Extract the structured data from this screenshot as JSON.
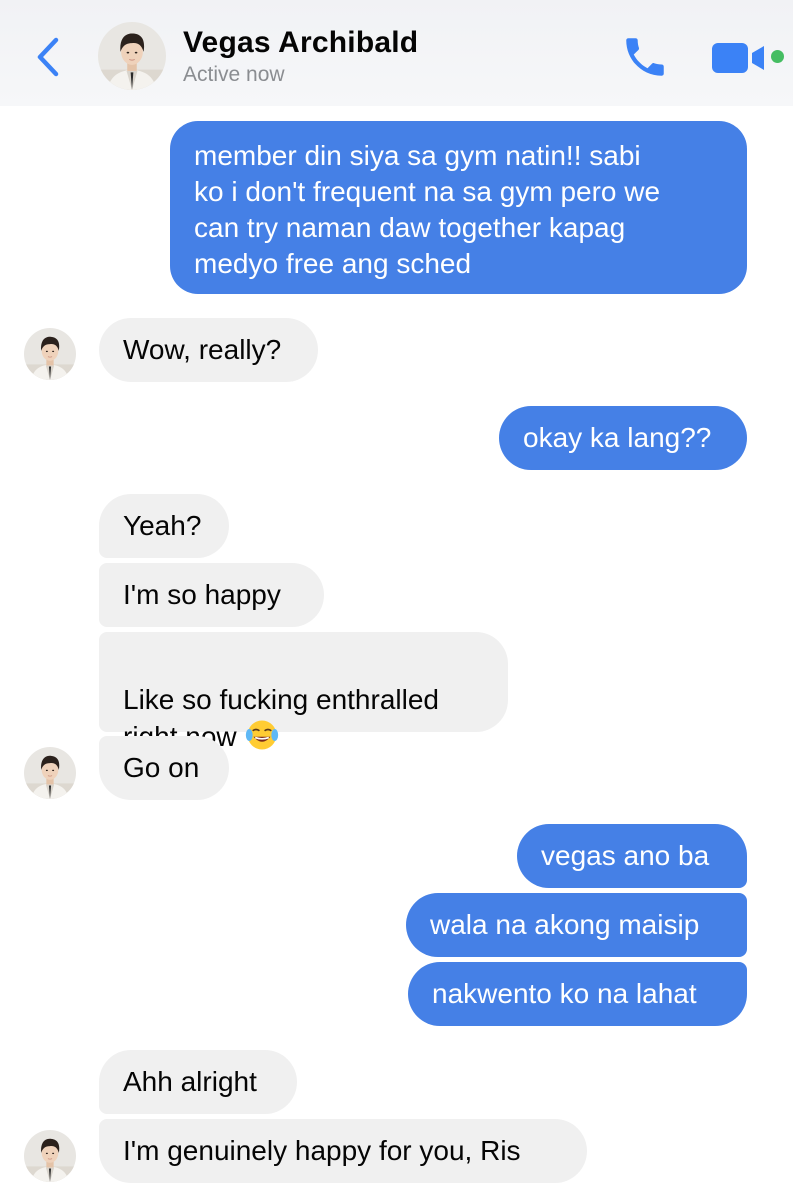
{
  "header": {
    "contact_name": "Vegas Archibald",
    "status": "Active now",
    "icons": {
      "back": "chevron-left-icon",
      "call": "phone-icon",
      "video": "video-camera-icon"
    },
    "accent": "#3b82f6",
    "online_color": "#45bd62"
  },
  "colors": {
    "outgoing": "#4580e6",
    "incoming": "#f0f0f0"
  },
  "messages": [
    {
      "from": "me",
      "text": "member din siya sa gym natin!! sabi\nko i don't frequent na sa gym pero we\ncan try naman daw together kapag\nmedyo free ang sched"
    },
    {
      "from": "them",
      "text": "Wow, really?"
    },
    {
      "from": "me",
      "text": "okay ka lang??"
    },
    {
      "from": "them",
      "text": "Yeah?"
    },
    {
      "from": "them",
      "text": "I'm so happy"
    },
    {
      "from": "them",
      "text": "Like so fucking enthralled\nright now",
      "emoji": "face-with-tears-of-joy-icon"
    },
    {
      "from": "them",
      "text": "Go on"
    },
    {
      "from": "me",
      "text": "vegas ano ba"
    },
    {
      "from": "me",
      "text": "wala na akong maisip"
    },
    {
      "from": "me",
      "text": "nakwento ko na lahat"
    },
    {
      "from": "them",
      "text": "Ahh alright"
    },
    {
      "from": "them",
      "text": "I'm genuinely happy for you, Ris"
    }
  ]
}
